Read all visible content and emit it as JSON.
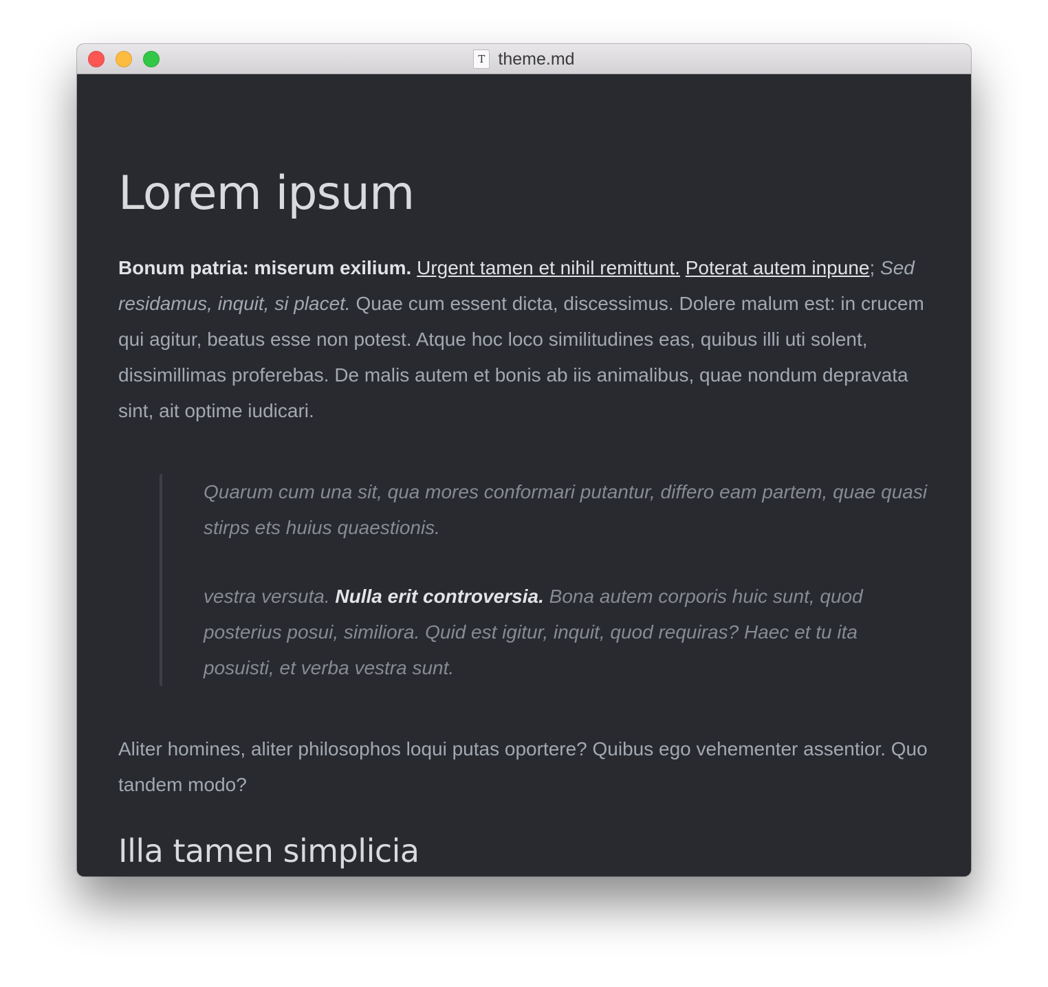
{
  "window": {
    "title": "theme.md",
    "doc_icon_glyph": "T"
  },
  "content": {
    "heading1": "Lorem ipsum",
    "paragraph1": {
      "bold": "Bonum patria: miserum exilium.",
      "link1": "Urgent tamen et nihil remittunt.",
      "link2": "Poterat autem inpune",
      "after_link2": ";",
      "italic": "Sed residamus, inquit, si placet.",
      "rest": "Quae cum essent dicta, discessimus. Dolere malum est: in crucem qui agitur, beatus esse non potest. Atque hoc loco similitudines eas, quibus illi uti solent, dissimillimas proferebas. De malis autem et bonis ab iis animalibus, quae nondum depravata sint, ait optime iudicari."
    },
    "blockquote": {
      "para1": "Quarum cum una sit, qua mores conformari putantur, differo eam partem, quae quasi stirps ets huius quaestionis.",
      "para2_start": "vestra versuta.",
      "para2_bold": "Nulla erit controversia.",
      "para2_end": "Bona autem corporis huic sunt, quod posterius posui, similiora. Quid est igitur, inquit, quod requiras? Haec et tu ita posuisti, et verba vestra sunt."
    },
    "paragraph2": "Aliter homines, aliter philosophos loqui putas oportere? Quibus ego vehementer assentior. Quo tandem modo?",
    "heading2": "Illa tamen simplicia"
  }
}
